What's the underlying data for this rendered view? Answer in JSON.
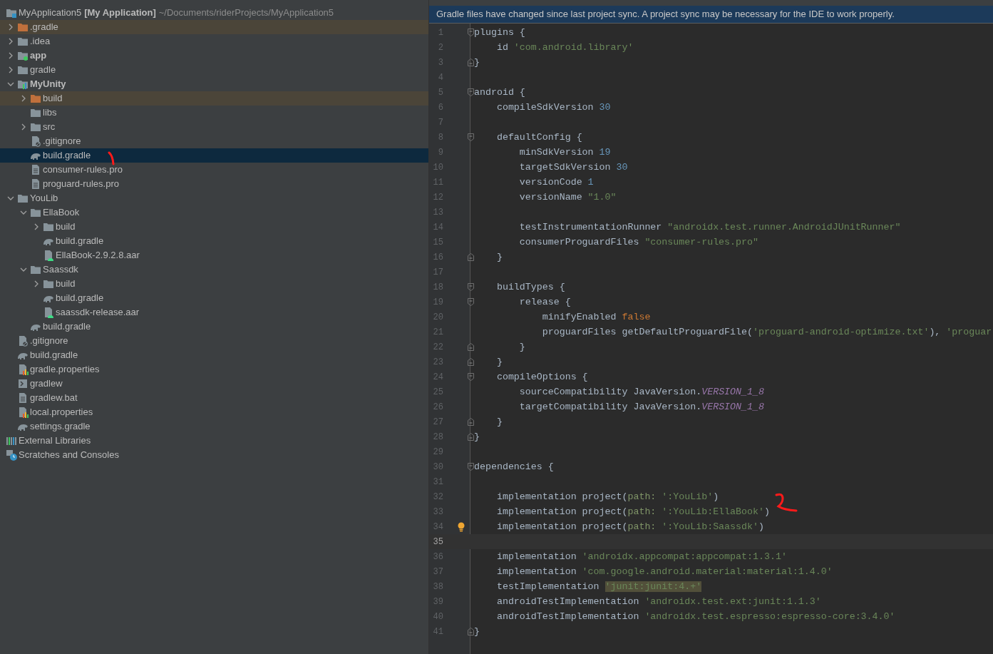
{
  "project_tree": {
    "root": {
      "label": "MyApplication5",
      "project_name": "[My Application]",
      "path": "~/Documents/riderProjects/MyApplication5",
      "kind": "project"
    },
    "items": [
      {
        "label": ".gradle",
        "kind": "folder",
        "expanded": false,
        "excluded": true,
        "selected": false
      },
      {
        "label": ".idea",
        "kind": "folder",
        "expanded": false,
        "excluded": false,
        "selected": false
      },
      {
        "label": "app",
        "kind": "app-module",
        "expanded": false,
        "excluded": false,
        "selected": false
      },
      {
        "label": "gradle",
        "kind": "folder",
        "expanded": false,
        "excluded": false,
        "selected": false
      },
      {
        "label": "MyUnity",
        "kind": "lib-module",
        "expanded": true,
        "excluded": false,
        "selected": false,
        "children": [
          {
            "label": "build",
            "kind": "folder",
            "expanded": false,
            "excluded": true,
            "selected": false
          },
          {
            "label": "libs",
            "kind": "folder",
            "excluded": false,
            "selected": false
          },
          {
            "label": "src",
            "kind": "folder",
            "expanded": false,
            "excluded": false,
            "selected": false
          },
          {
            "label": ".gitignore",
            "kind": "ignore",
            "excluded": false,
            "selected": false
          },
          {
            "label": "build.gradle",
            "kind": "gradle",
            "excluded": false,
            "selected": true
          },
          {
            "label": "consumer-rules.pro",
            "kind": "text",
            "excluded": false,
            "selected": false
          },
          {
            "label": "proguard-rules.pro",
            "kind": "text",
            "excluded": false,
            "selected": false
          }
        ]
      },
      {
        "label": "YouLib",
        "kind": "folder",
        "expanded": true,
        "excluded": false,
        "selected": false,
        "children": [
          {
            "label": "EllaBook",
            "kind": "folder",
            "expanded": true,
            "excluded": false,
            "selected": false,
            "children": [
              {
                "label": "build",
                "kind": "folder",
                "expanded": false,
                "excluded": false,
                "selected": false
              },
              {
                "label": "build.gradle",
                "kind": "gradle",
                "excluded": false,
                "selected": false
              },
              {
                "label": "EllaBook-2.9.2.8.aar",
                "kind": "aar",
                "excluded": false,
                "selected": false
              }
            ]
          },
          {
            "label": "Saassdk",
            "kind": "folder",
            "expanded": true,
            "excluded": false,
            "selected": false,
            "children": [
              {
                "label": "build",
                "kind": "folder",
                "expanded": false,
                "excluded": false,
                "selected": false
              },
              {
                "label": "build.gradle",
                "kind": "gradle",
                "excluded": false,
                "selected": false
              },
              {
                "label": "saassdk-release.aar",
                "kind": "aar",
                "excluded": false,
                "selected": false
              }
            ]
          },
          {
            "label": "build.gradle",
            "kind": "gradle",
            "excluded": false,
            "selected": false
          }
        ]
      },
      {
        "label": ".gitignore",
        "kind": "ignore",
        "excluded": false,
        "selected": false
      },
      {
        "label": "build.gradle",
        "kind": "gradle",
        "excluded": false,
        "selected": false
      },
      {
        "label": "gradle.properties",
        "kind": "properties",
        "excluded": false,
        "selected": false
      },
      {
        "label": "gradlew",
        "kind": "script",
        "excluded": false,
        "selected": false
      },
      {
        "label": "gradlew.bat",
        "kind": "text",
        "excluded": false,
        "selected": false
      },
      {
        "label": "local.properties",
        "kind": "properties",
        "excluded": false,
        "selected": false
      },
      {
        "label": "settings.gradle",
        "kind": "gradle",
        "excluded": false,
        "selected": false
      }
    ],
    "bottom_items": [
      {
        "label": "External Libraries",
        "kind": "libraries"
      },
      {
        "label": "Scratches and Consoles",
        "kind": "scratches"
      }
    ]
  },
  "editor": {
    "banner": "Gradle files have changed since last project sync. A project sync may be necessary for the IDE to work properly.",
    "lines": [
      {
        "number": "1",
        "fold_start": true,
        "tokens": [
          {
            "kind": "plain",
            "text": "plugins {"
          }
        ]
      },
      {
        "number": "2",
        "tokens": [
          {
            "kind": "plain",
            "text": "    id "
          },
          {
            "kind": "string",
            "text": "'com.android.library'"
          }
        ]
      },
      {
        "number": "3",
        "fold_end": true,
        "tokens": [
          {
            "kind": "plain",
            "text": "}"
          }
        ]
      },
      {
        "number": "4"
      },
      {
        "number": "5",
        "fold_start": true,
        "tokens": [
          {
            "kind": "plain",
            "text": "android {"
          }
        ]
      },
      {
        "number": "6",
        "tokens": [
          {
            "kind": "plain",
            "text": "    compileSdkVersion "
          },
          {
            "kind": "number",
            "text": "30"
          }
        ]
      },
      {
        "number": "7"
      },
      {
        "number": "8",
        "fold_start": true,
        "tokens": [
          {
            "kind": "plain",
            "text": "    defaultConfig {"
          }
        ]
      },
      {
        "number": "9",
        "tokens": [
          {
            "kind": "plain",
            "text": "        minSdkVersion "
          },
          {
            "kind": "number",
            "text": "19"
          }
        ]
      },
      {
        "number": "10",
        "tokens": [
          {
            "kind": "plain",
            "text": "        targetSdkVersion "
          },
          {
            "kind": "number",
            "text": "30"
          }
        ]
      },
      {
        "number": "11",
        "tokens": [
          {
            "kind": "plain",
            "text": "        versionCode "
          },
          {
            "kind": "number",
            "text": "1"
          }
        ]
      },
      {
        "number": "12",
        "tokens": [
          {
            "kind": "plain",
            "text": "        versionName "
          },
          {
            "kind": "string",
            "text": "\"1.0\""
          }
        ]
      },
      {
        "number": "13"
      },
      {
        "number": "14",
        "tokens": [
          {
            "kind": "plain",
            "text": "        testInstrumentationRunner "
          },
          {
            "kind": "string",
            "text": "\"androidx.test.runner.AndroidJUnitRunner\""
          }
        ]
      },
      {
        "number": "15",
        "tokens": [
          {
            "kind": "plain",
            "text": "        consumerProguardFiles "
          },
          {
            "kind": "string",
            "text": "\"consumer-rules.pro\""
          }
        ]
      },
      {
        "number": "16",
        "fold_end": true,
        "tokens": [
          {
            "kind": "plain",
            "text": "    }"
          }
        ]
      },
      {
        "number": "17"
      },
      {
        "number": "18",
        "fold_start": true,
        "tokens": [
          {
            "kind": "plain",
            "text": "    buildTypes {"
          }
        ]
      },
      {
        "number": "19",
        "fold_start": true,
        "tokens": [
          {
            "kind": "plain",
            "text": "        release {"
          }
        ]
      },
      {
        "number": "20",
        "tokens": [
          {
            "kind": "plain",
            "text": "            minifyEnabled "
          },
          {
            "kind": "keyword",
            "text": "false"
          }
        ]
      },
      {
        "number": "21",
        "tokens": [
          {
            "kind": "plain",
            "text": "            proguardFiles getDefaultProguardFile("
          },
          {
            "kind": "string",
            "text": "'proguard-android-optimize.txt'"
          },
          {
            "kind": "plain",
            "text": "), "
          },
          {
            "kind": "string",
            "text": "'proguar"
          }
        ]
      },
      {
        "number": "22",
        "fold_end": true,
        "tokens": [
          {
            "kind": "plain",
            "text": "        }"
          }
        ]
      },
      {
        "number": "23",
        "fold_end": true,
        "tokens": [
          {
            "kind": "plain",
            "text": "    }"
          }
        ]
      },
      {
        "number": "24",
        "fold_start": true,
        "tokens": [
          {
            "kind": "plain",
            "text": "    compileOptions {"
          }
        ]
      },
      {
        "number": "25",
        "tokens": [
          {
            "kind": "plain",
            "text": "        sourceCompatibility JavaVersion."
          },
          {
            "kind": "constant",
            "text": "VERSION_1_8"
          }
        ]
      },
      {
        "number": "26",
        "tokens": [
          {
            "kind": "plain",
            "text": "        targetCompatibility JavaVersion."
          },
          {
            "kind": "constant",
            "text": "VERSION_1_8"
          }
        ]
      },
      {
        "number": "27",
        "fold_end": true,
        "tokens": [
          {
            "kind": "plain",
            "text": "    }"
          }
        ]
      },
      {
        "number": "28",
        "fold_end": true,
        "tokens": [
          {
            "kind": "plain",
            "text": "}"
          }
        ]
      },
      {
        "number": "29"
      },
      {
        "number": "30",
        "fold_start": true,
        "tokens": [
          {
            "kind": "plain",
            "text": "dependencies {"
          }
        ]
      },
      {
        "number": "31"
      },
      {
        "number": "32",
        "tokens": [
          {
            "kind": "plain",
            "text": "    implementation project("
          },
          {
            "kind": "param",
            "text": "path:"
          },
          {
            "kind": "string",
            "text": "':YouLib'"
          },
          {
            "kind": "plain",
            "text": ")"
          }
        ]
      },
      {
        "number": "33",
        "tokens": [
          {
            "kind": "plain",
            "text": "    implementation project("
          },
          {
            "kind": "param",
            "text": "path:"
          },
          {
            "kind": "string",
            "text": "':YouLib:EllaBook'"
          },
          {
            "kind": "plain",
            "text": ")"
          }
        ]
      },
      {
        "number": "34",
        "bulb": true,
        "tokens": [
          {
            "kind": "plain",
            "text": "    implementation project("
          },
          {
            "kind": "param",
            "text": "path:"
          },
          {
            "kind": "string",
            "text": "':YouLib:Saassdk'"
          },
          {
            "kind": "plain",
            "text": ")"
          }
        ]
      },
      {
        "number": "35",
        "current": true
      },
      {
        "number": "36",
        "tokens": [
          {
            "kind": "plain",
            "text": "    implementation "
          },
          {
            "kind": "string",
            "text": "'androidx.appcompat:appcompat:1.3.1'"
          }
        ]
      },
      {
        "number": "37",
        "tokens": [
          {
            "kind": "plain",
            "text": "    implementation "
          },
          {
            "kind": "string",
            "text": "'com.google.android.material:material:1.4.0'"
          }
        ]
      },
      {
        "number": "38",
        "tokens": [
          {
            "kind": "plain",
            "text": "    testImplementation "
          },
          {
            "kind": "warning",
            "text": "'junit:junit:4.+'"
          }
        ]
      },
      {
        "number": "39",
        "tokens": [
          {
            "kind": "plain",
            "text": "    androidTestImplementation "
          },
          {
            "kind": "string",
            "text": "'androidx.test.ext:junit:1.1.3'"
          }
        ]
      },
      {
        "number": "40",
        "tokens": [
          {
            "kind": "plain",
            "text": "    androidTestImplementation "
          },
          {
            "kind": "string",
            "text": "'androidx.test.espresso:espresso-core:3.4.0'"
          }
        ]
      },
      {
        "number": "41",
        "fold_end": true,
        "tokens": [
          {
            "kind": "plain",
            "text": "}"
          }
        ]
      }
    ]
  }
}
